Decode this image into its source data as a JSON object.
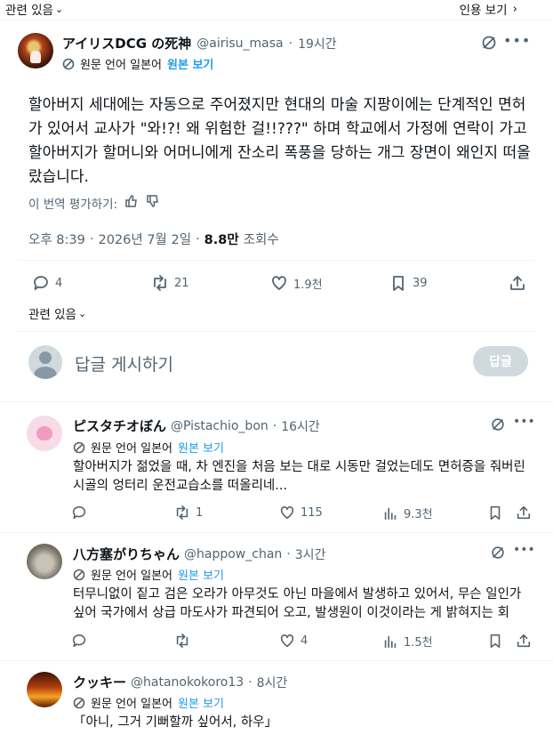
{
  "top_bar": {
    "related_label": "관련 있음",
    "quote_label": "인용 보기"
  },
  "main_post": {
    "display_name": "アイリスDCG の死神",
    "handle": "@airisu_masa",
    "time": "19시간",
    "translate": {
      "language_label": "원문 언어 일본어",
      "show_original": "원본 보기"
    },
    "text": "할아버지 세대에는 자동으로 주어졌지만 현대의 마술 지팡이에는 단계적인 면허가 있어서 교사가 \"와!?! 왜 위험한 걸!!???\" 하며 학교에서 가정에 연락이 가고 할아버지가 할머니와 어머니에게 잔소리 폭풍을 당하는 개그 장면이 왜인지 떠올랐습니다.",
    "rate_translation": "이 번역 평가하기:",
    "meta": {
      "time": "오후 8:39",
      "date": "2026년 7월 2일",
      "views": "8.8만",
      "views_label": "조회수"
    },
    "stats": {
      "replies": "4",
      "reposts": "21",
      "likes": "1.9천",
      "bookmarks": "39"
    },
    "related_label": "관련 있음"
  },
  "compose": {
    "placeholder": "답글 게시하기",
    "reply_button": "답글"
  },
  "replies": [
    {
      "display_name": "ピスタチオぼん",
      "handle": "@Pistachio_bon",
      "time": "16시간",
      "language_label": "원문 언어 일본어",
      "show_original": "원본 보기",
      "text": "할아버지가 젊었을 때, 차 엔진을 처음 보는 대로 시동만 걸었는데도 면허증을 줘버린 시골의 엉터리 운전교습소를 떠올리네...",
      "stats": {
        "replies": "",
        "reposts": "1",
        "likes": "115",
        "views": "9.3천"
      }
    },
    {
      "display_name": "八方塞がりちゃん",
      "handle": "@happow_chan",
      "time": "3시간",
      "language_label": "원문 언어 일본어",
      "show_original": "원본 보기",
      "text": "터무니없이 짙고 검은 오라가 아무것도 아닌 마을에서 발생하고 있어서, 무슨 일인가 싶어 국가에서 상급 마도사가 파견되어 오고, 발생원이 이것이라는 게 밝혀지는 회",
      "stats": {
        "replies": "",
        "reposts": "",
        "likes": "4",
        "views": "1.5천"
      }
    },
    {
      "display_name": "クッキー",
      "handle": "@hatanokokoro13",
      "time": "8시간",
      "language_label": "원문 언어 일본어",
      "show_original": "원본 보기",
      "text": "「아니, 그거 기뻐할까 싶어서, 하우」"
    }
  ],
  "meta_sep": "·",
  "colors": {
    "accent": "#1d9bf0",
    "text": "#0f1419",
    "muted": "#536471",
    "divider": "#eff3f4"
  }
}
